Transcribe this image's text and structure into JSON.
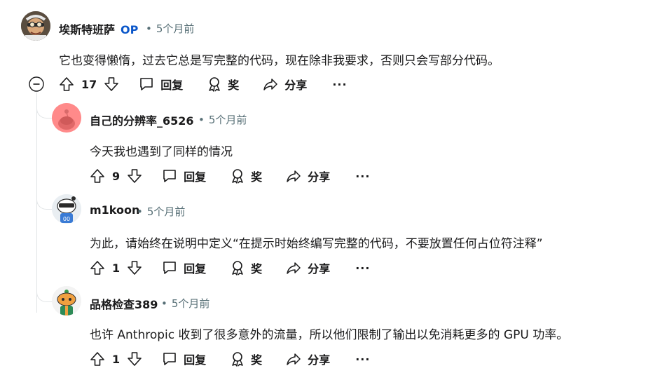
{
  "comments": [
    {
      "author": "埃斯特班萨",
      "op_badge": "OP",
      "time": "5个月前",
      "text": "它也变得懒惰，过去它总是写完整的代码，现在除非我要求，否则只会写部分代码。",
      "votes": "17",
      "reply_label": "回复",
      "award_label": "奖",
      "share_label": "分享",
      "more_label": "···"
    },
    {
      "author": "自己的分辨率_6526",
      "time": "5个月前",
      "text": "今天我也遇到了同样的情况",
      "votes": "9",
      "reply_label": "回复",
      "award_label": "奖",
      "share_label": "分享",
      "more_label": "···"
    },
    {
      "author": "m1koon",
      "time": "5个月前",
      "text": "为此，请始终在说明中定义“在提示时始终编写完整的代码，不要放置任何占位符注释”",
      "votes": "1",
      "reply_label": "回复",
      "award_label": "奖",
      "share_label": "分享",
      "more_label": "···"
    },
    {
      "author": "品格检查389",
      "time": "5个月前",
      "text": "也许 Anthropic 收到了很多意外的流量，所以他们限制了输出以免消耗更多的 GPU 功率。",
      "votes": "1",
      "reply_label": "回复",
      "award_label": "奖",
      "share_label": "分享",
      "more_label": "···"
    }
  ],
  "dot_separator": "•",
  "icons": {
    "collapse": "collapse-minus-icon",
    "upvote": "upvote-arrow-icon",
    "downvote": "downvote-arrow-icon",
    "reply": "speech-bubble-icon",
    "award": "award-ribbon-icon",
    "share": "share-arrow-icon"
  },
  "colors": {
    "op_badge": "#0a56c9",
    "meta": "#576f76",
    "thread_line": "#e1e4e6",
    "snoo_avatar_bg": "#ff8a8a"
  }
}
